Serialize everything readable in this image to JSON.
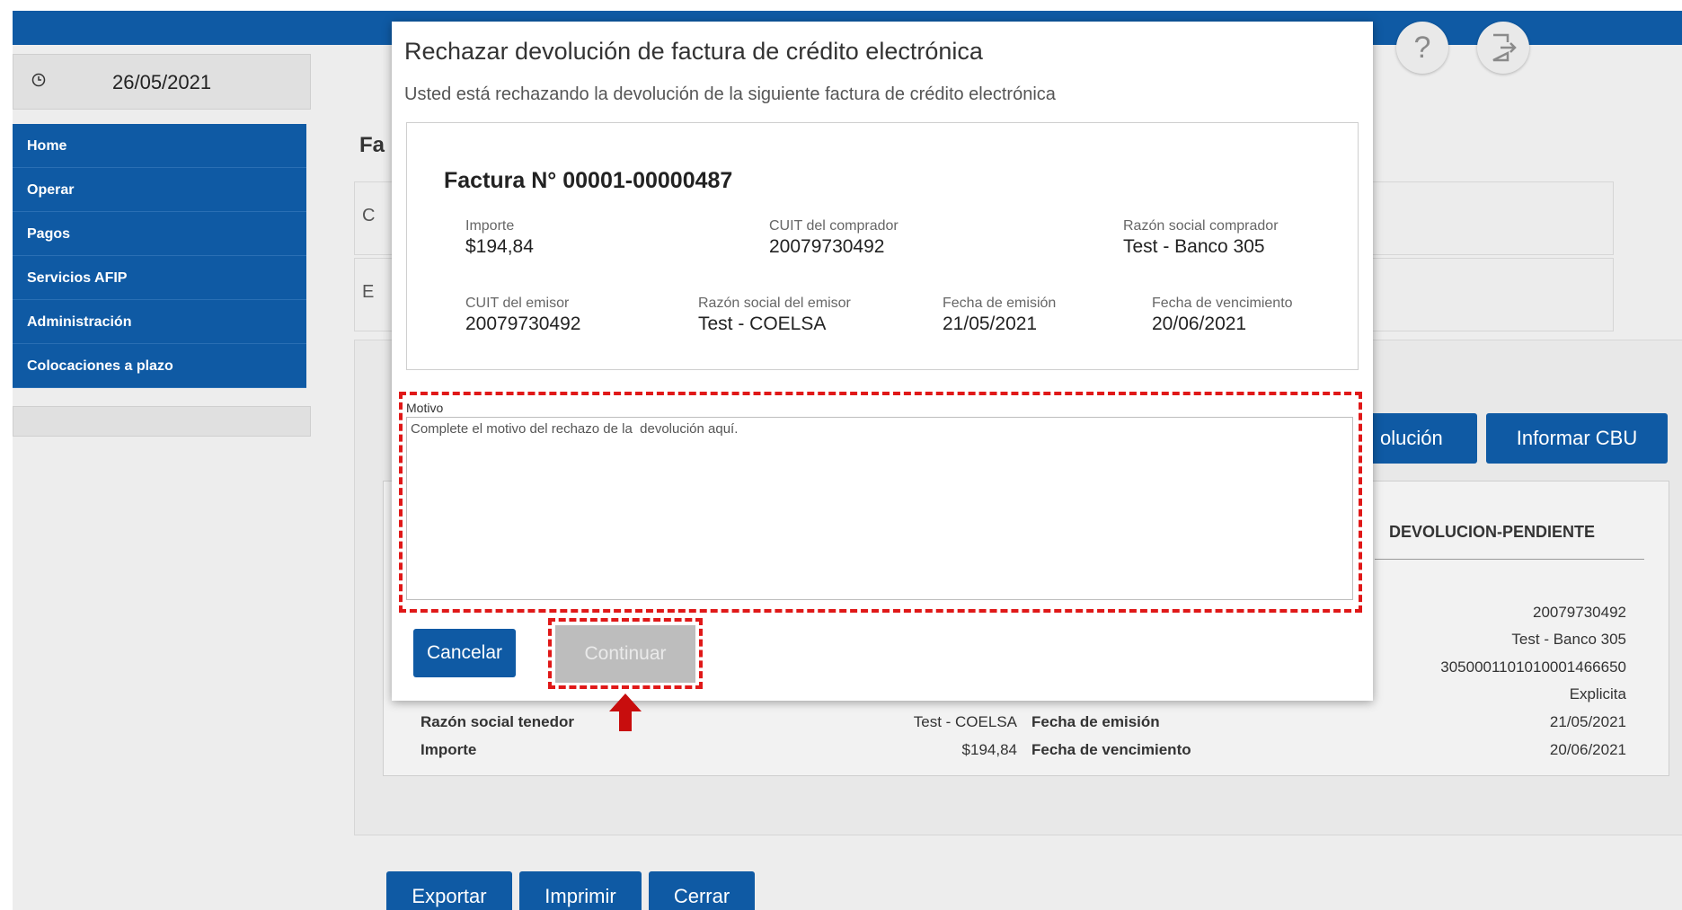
{
  "app": {
    "date": "26/05/2021",
    "menu": [
      "Home",
      "Operar",
      "Pagos",
      "Servicios AFIP",
      "Administración",
      "Colocaciones a plazo"
    ],
    "page_title_fragment": "Fa",
    "panel_fragment_1": "C",
    "panel_fragment_2": "E",
    "buttons": {
      "devolucion_fragment": "olución",
      "informar_cbu": "Informar CBU",
      "exportar": "Exportar",
      "imprimir": "Imprimir",
      "cerrar": "Cerrar"
    },
    "table": {
      "status_header": "DEVOLUCION-PENDIENTE",
      "right_values": [
        "20079730492",
        "Test - Banco 305",
        "3050001101010001466650",
        "Explicita",
        "21/05/2021",
        "20/06/2021"
      ],
      "left_rows": [
        {
          "label": "Razón social tenedor",
          "value": "Test - COELSA"
        },
        {
          "label": "Importe",
          "value": "$194,84"
        }
      ],
      "middle_labels": [
        "Fecha de emisión",
        "Fecha de vencimiento"
      ]
    },
    "colors": {
      "primary": "#0f5aa4",
      "highlight": "#e01818",
      "disabled": "#bdbdbd"
    }
  },
  "modal": {
    "title": "Rechazar devolución de factura de crédito electrónica",
    "subtitle": "Usted está rechazando la devolución de la siguiente factura de crédito electrónica",
    "invoice": {
      "title": "Factura N° 00001-00000487",
      "importe_label": "Importe",
      "importe": "$194,84",
      "cuit_comprador_label": "CUIT del comprador",
      "cuit_comprador": "20079730492",
      "razon_comprador_label": "Razón social comprador",
      "razon_comprador": "Test - Banco 305",
      "cuit_emisor_label": "CUIT del emisor",
      "cuit_emisor": "20079730492",
      "razon_emisor_label": "Razón social del emisor",
      "razon_emisor": "Test - COELSA",
      "fecha_emision_label": "Fecha de emisión",
      "fecha_emision": "21/05/2021",
      "fecha_vencimiento_label": "Fecha de vencimiento",
      "fecha_vencimiento": "20/06/2021"
    },
    "motivo_label": "Motivo",
    "motivo_placeholder": "Complete el motivo del rechazo de la  devolución aquí.",
    "motivo_value": "",
    "cancel_label": "Cancelar",
    "continue_label": "Continuar"
  }
}
